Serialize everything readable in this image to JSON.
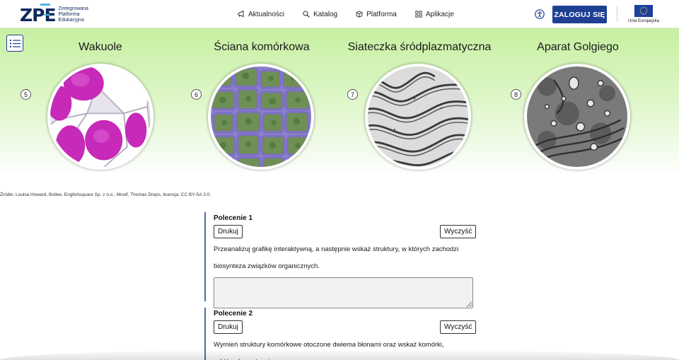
{
  "header": {
    "logo_mark": "ZPE",
    "logo_lines": [
      "Zintegrowana",
      "Platforma",
      "Edukacyjna"
    ],
    "nav": [
      {
        "label": "Aktualności",
        "icon": "megaphone-icon"
      },
      {
        "label": "Katalog",
        "icon": "search-icon"
      },
      {
        "label": "Platforma",
        "icon": "cube-icon"
      },
      {
        "label": "Aplikacje",
        "icon": "grid-icon"
      }
    ],
    "accessibility_icon": "accessibility-icon",
    "login_label": "ZALOGUJ SIĘ",
    "eu_label": "Unia Europejska"
  },
  "gallery": {
    "menu_icon": "list-icon",
    "items": [
      {
        "number": "5",
        "title": "Wakuole"
      },
      {
        "number": "6",
        "title": "Ściana komórkowa"
      },
      {
        "number": "7",
        "title": "Siateczka śródplazmatyczna"
      },
      {
        "number": "8",
        "title": "Aparat Golgiego"
      }
    ],
    "source": "Źródło: Louisa Howard, Bstlee, Englishsquare Sp. z o.o., Mnolf, Thomas Dreps, licencja: CC BY-SA 3.0."
  },
  "tasks": [
    {
      "title": "Polecenie 1",
      "print_label": "Drukuj",
      "clear_label": "Wyczyść",
      "text_lines": [
        "Przeanalizuj grafikę interaktywną, a następnie wskaż struktury, w których zachodzi",
        "biosynteza związków organicznych."
      ]
    },
    {
      "title": "Polecenie 2",
      "print_label": "Drukuj",
      "clear_label": "Wyczyść",
      "text_lines": [
        "Wymień struktury komórkowe otoczone dwiema błonami oraz wskaż komórki,",
        "w których występują."
      ]
    }
  ],
  "colors": {
    "brand_blue": "#1f3f93",
    "gallery_green": "#c7f0a1",
    "task_border": "#4a6fa5"
  }
}
